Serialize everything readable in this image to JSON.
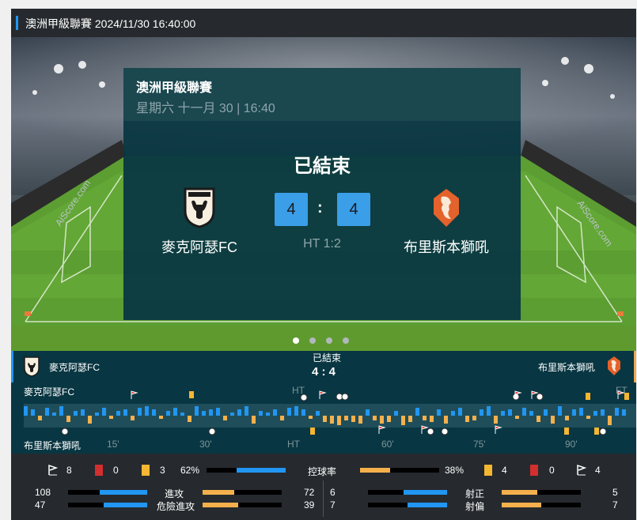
{
  "header": {
    "title": "澳洲甲級聯賽 2024/11/30 16:40:00"
  },
  "match": {
    "league": "澳洲甲級聯賽",
    "date": "星期六 十一月 30 | 16:40",
    "status": "已結束",
    "home_score": "4",
    "away_score": "4",
    "colon": ":",
    "halftime": "HT 1:2",
    "home_team": "麥克阿瑟FC",
    "away_team": "布里斯本獅吼",
    "score_line": "4 : 4",
    "watermark": "AiScore.com"
  },
  "timeline": {
    "home_label": "麥克阿瑟FC",
    "away_label": "布里斯本獅吼",
    "ht_top": "HT",
    "ft_top": "FT",
    "ticks": [
      "15'",
      "30'",
      "HT",
      "60'",
      "75'",
      "90'"
    ]
  },
  "stats": {
    "home_corners": "8",
    "home_red": "0",
    "home_yellow": "3",
    "possession_home": "62%",
    "possession_label": "控球率",
    "possession_away": "38%",
    "away_yellow": "4",
    "away_red": "0",
    "away_corners": "4",
    "possession_home_value": 62,
    "possession_away_value": 38,
    "rows_left": [
      {
        "home": "108",
        "label": "進攻",
        "away": "72",
        "home_val": 108,
        "away_val": 72
      },
      {
        "home": "47",
        "label": "危險進攻",
        "away": "39",
        "home_val": 47,
        "away_val": 39
      }
    ],
    "rows_right": [
      {
        "home": "6",
        "label": "射正",
        "away": "5",
        "home_val": 6,
        "away_val": 5
      },
      {
        "home": "7",
        "label": "射偏",
        "away": "7",
        "home_val": 7,
        "away_val": 7
      }
    ]
  },
  "colors": {
    "home": "#2196f3",
    "away": "#f5b04c",
    "card_bg": "#083642",
    "accent": "#2196f3"
  }
}
